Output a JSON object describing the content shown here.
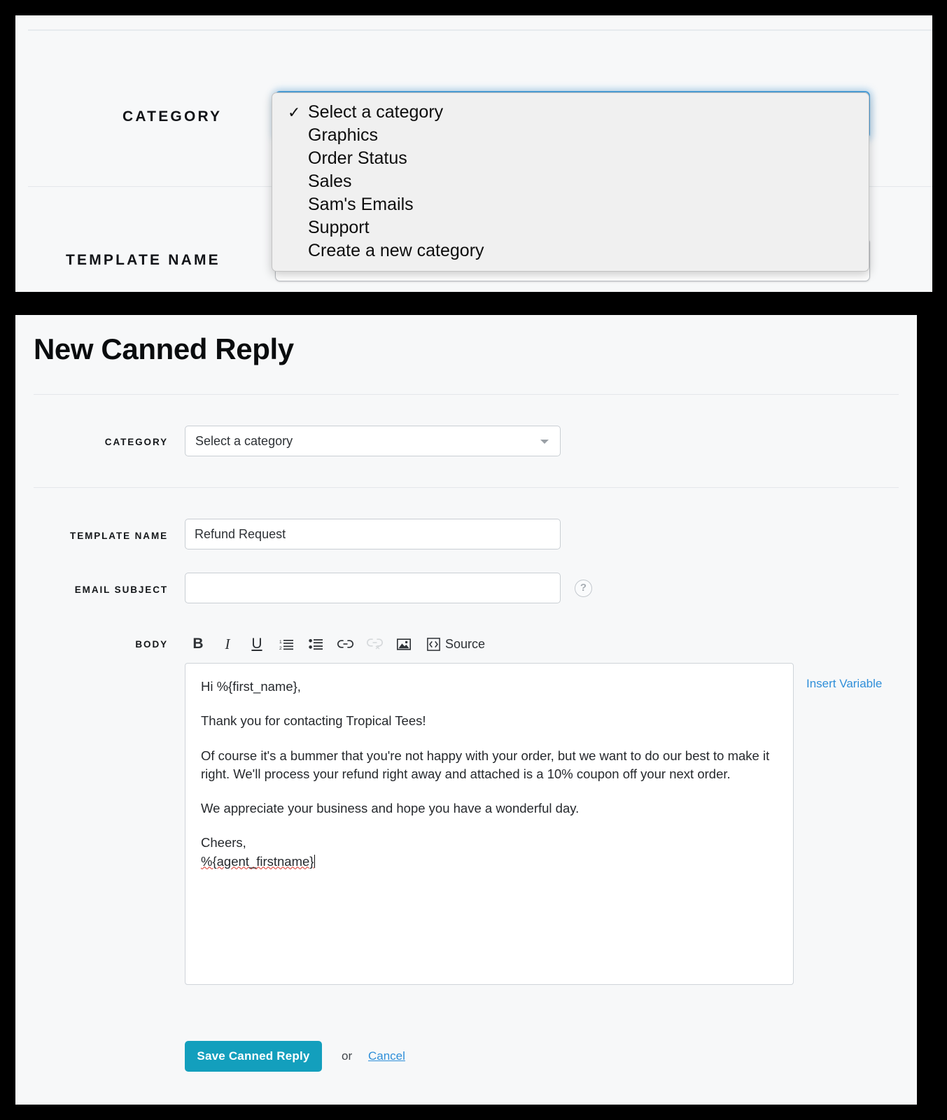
{
  "zoom_panel": {
    "category_label": "CATEGORY",
    "template_name_label": "TEMPLATE NAME",
    "template_name_value": "Refund Request",
    "dropdown": {
      "selected_index": 0,
      "check_glyph": "✓",
      "options": [
        "Select a category",
        "Graphics",
        "Order Status",
        "Sales",
        "Sam's Emails",
        "Support",
        "Create a new category"
      ]
    }
  },
  "form": {
    "title": "New Canned Reply",
    "labels": {
      "category": "CATEGORY",
      "template_name": "TEMPLATE NAME",
      "email_subject": "EMAIL SUBJECT",
      "body": "BODY"
    },
    "category": {
      "selected_value": "Select a category",
      "options": [
        "Select a category",
        "Graphics",
        "Order Status",
        "Sales",
        "Sam's Emails",
        "Support",
        "Create a new category"
      ],
      "arrow_icon": "chevron-down-icon"
    },
    "template_name": {
      "value": "Refund Request",
      "placeholder": ""
    },
    "email_subject": {
      "value": "",
      "placeholder": "",
      "help_icon_glyph": "?"
    },
    "toolbar": [
      {
        "name": "bold-icon",
        "label": "B",
        "disabled": false
      },
      {
        "name": "italic-icon",
        "label": "I",
        "disabled": false
      },
      {
        "name": "underline-icon",
        "label": "U",
        "disabled": false
      },
      {
        "name": "numbered-list-icon",
        "label": "",
        "disabled": false
      },
      {
        "name": "bulleted-list-icon",
        "label": "",
        "disabled": false
      },
      {
        "name": "link-icon",
        "label": "",
        "disabled": false
      },
      {
        "name": "unlink-icon",
        "label": "",
        "disabled": true
      },
      {
        "name": "image-icon",
        "label": "",
        "disabled": false
      },
      {
        "name": "source-icon",
        "label": "Source",
        "disabled": false
      }
    ],
    "source_label": "Source",
    "body_paragraphs": [
      "Hi %{first_name},",
      "Thank you for contacting Tropical Tees!",
      "Of course it's a bummer that you're not happy with your order, but we want to do our best to make it right. We'll process your refund right away and attached is a 10% coupon off your next order.",
      "We appreciate your business and hope you have a wonderful day."
    ],
    "body_signoff": "Cheers,",
    "body_signature": "%{agent_firstname}",
    "insert_variable_label": "Insert Variable",
    "save_label": "Save Canned Reply",
    "or_label": "or",
    "cancel_label": "Cancel"
  },
  "colors": {
    "accent_teal": "#139fbd",
    "link_blue": "#2f8fd9",
    "panel_bg": "#f7f8f9",
    "focus_blue": "#4ea3dd",
    "spellcheck_red": "#d93025"
  }
}
